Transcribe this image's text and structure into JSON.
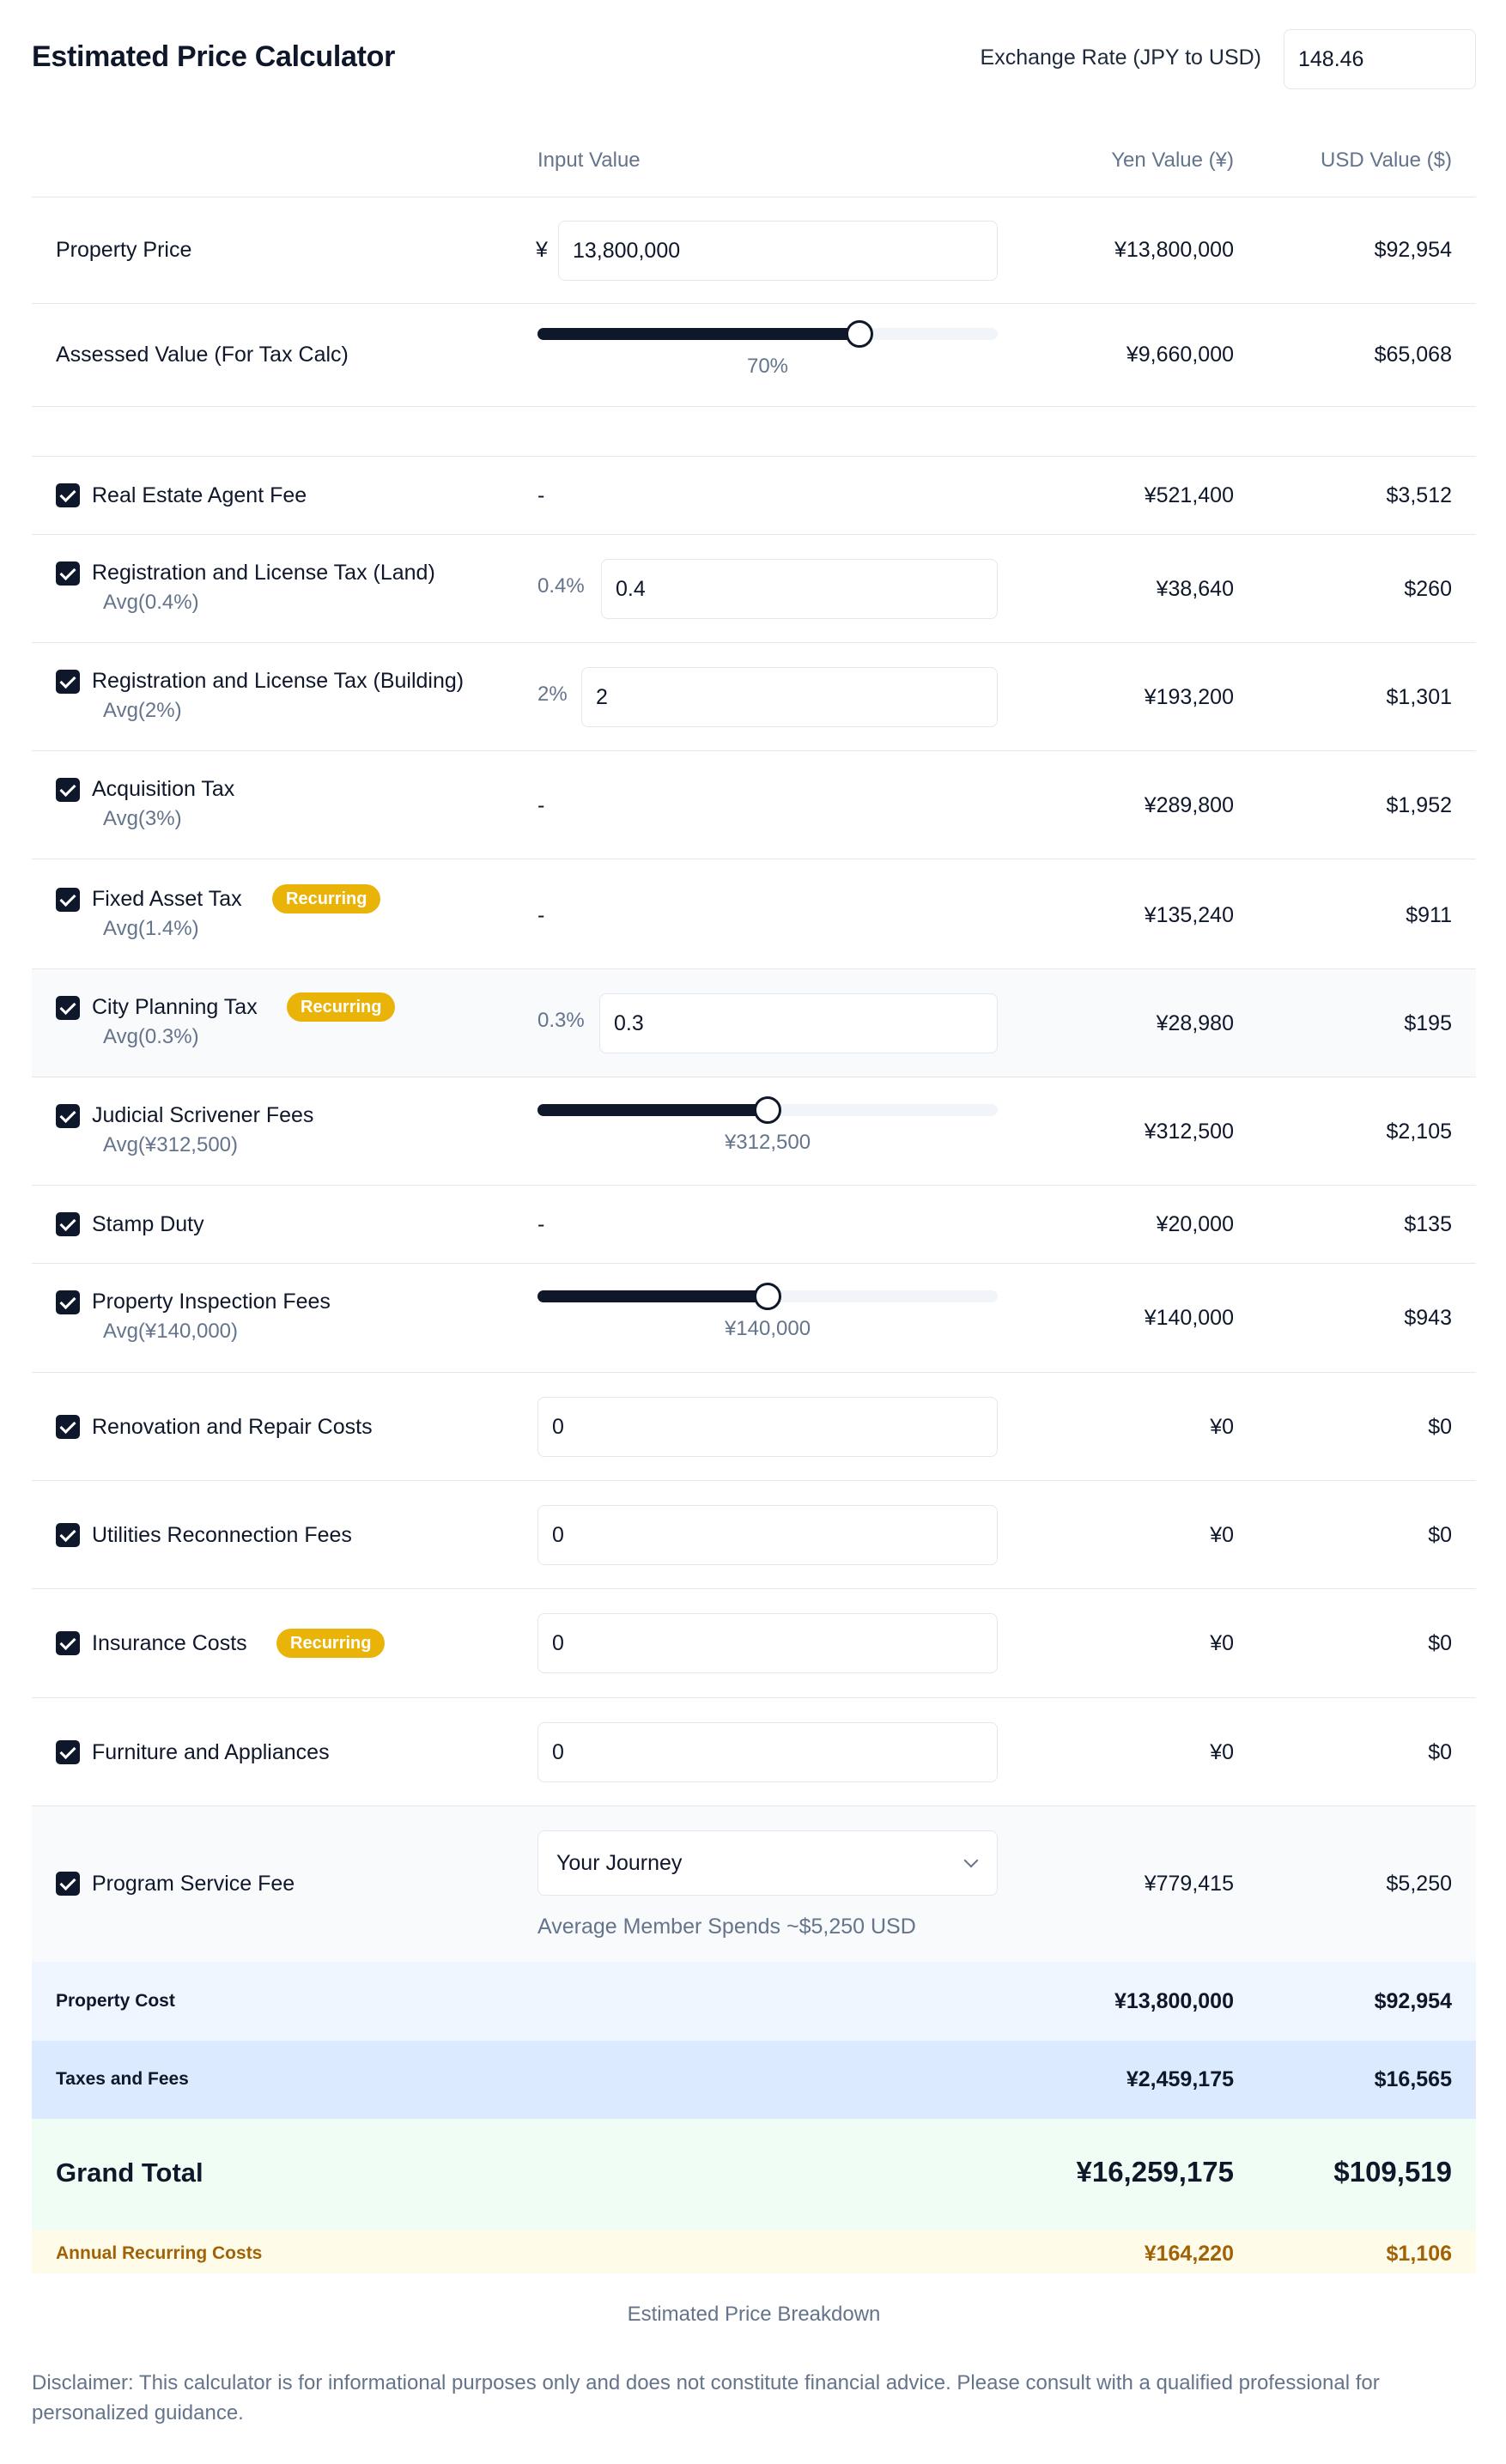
{
  "header": {
    "title": "Estimated Price Calculator",
    "rate_label": "Exchange Rate (JPY to USD)",
    "rate_value": "148.46"
  },
  "columns": {
    "input": "Input Value",
    "yen": "Yen Value (¥)",
    "usd": "USD Value ($)"
  },
  "property": {
    "label": "Property Price",
    "currency_symbol": "¥",
    "input_value": "13,800,000",
    "yen": "¥13,800,000",
    "usd": "$92,954"
  },
  "assessed": {
    "label": "Assessed Value (For Tax Calc)",
    "slider_percent": 70,
    "slider_label": "70%",
    "yen": "¥9,660,000",
    "usd": "$65,068"
  },
  "badge_label": "Recurring",
  "fees": [
    {
      "label": "Real Estate Agent Fee",
      "avg": "",
      "input": "-",
      "yen": "¥521,400",
      "usd": "$3,512",
      "checked": true
    },
    {
      "label": "Registration and License Tax (Land)",
      "avg": "Avg(0.4%)",
      "rate": "0.4%",
      "input": "0.4",
      "yen": "¥38,640",
      "usd": "$260",
      "checked": true
    },
    {
      "label": "Registration and License Tax (Building)",
      "avg": "Avg(2%)",
      "rate": "2%",
      "input": "2",
      "yen": "¥193,200",
      "usd": "$1,301",
      "checked": true
    },
    {
      "label": "Acquisition Tax",
      "avg": "Avg(3%)",
      "input": "-",
      "yen": "¥289,800",
      "usd": "$1,952",
      "checked": true
    },
    {
      "label": "Fixed Asset Tax",
      "avg": "Avg(1.4%)",
      "input": "-",
      "yen": "¥135,240",
      "usd": "$911",
      "checked": true,
      "recurring": true
    },
    {
      "label": "City Planning Tax",
      "avg": "Avg(0.3%)",
      "rate": "0.3%",
      "input": "0.3",
      "yen": "¥28,980",
      "usd": "$195",
      "checked": true,
      "recurring": true
    },
    {
      "label": "Judicial Scrivener Fees",
      "avg": "Avg(¥312,500)",
      "slider_fraction": 0.5,
      "slider_label": "¥312,500",
      "yen": "¥312,500",
      "usd": "$2,105",
      "checked": true
    },
    {
      "label": "Stamp Duty",
      "avg": "",
      "input": "-",
      "yen": "¥20,000",
      "usd": "$135",
      "checked": true
    },
    {
      "label": "Property Inspection Fees",
      "avg": "Avg(¥140,000)",
      "slider_fraction": 0.5,
      "slider_label": "¥140,000",
      "yen": "¥140,000",
      "usd": "$943",
      "checked": true
    },
    {
      "label": "Renovation and Repair Costs",
      "input": "0",
      "yen": "¥0",
      "usd": "$0",
      "checked": true
    },
    {
      "label": "Utilities Reconnection Fees",
      "input": "0",
      "yen": "¥0",
      "usd": "$0",
      "checked": true
    },
    {
      "label": "Insurance Costs",
      "input": "0",
      "yen": "¥0",
      "usd": "$0",
      "checked": true,
      "recurring": true
    },
    {
      "label": "Furniture and Appliances",
      "input": "0",
      "yen": "¥0",
      "usd": "$0",
      "checked": true
    },
    {
      "label": "Program Service Fee",
      "select_value": "Your Journey",
      "note": "Average Member Spends ~$5,250 USD",
      "yen": "¥779,415",
      "usd": "$5,250",
      "checked": true
    }
  ],
  "summary": {
    "property_cost": {
      "label": "Property Cost",
      "yen": "¥13,800,000",
      "usd": "$92,954"
    },
    "taxes_fees": {
      "label": "Taxes and Fees",
      "yen": "¥2,459,175",
      "usd": "$16,565"
    },
    "grand_total": {
      "label": "Grand Total",
      "yen": "¥16,259,175",
      "usd": "$109,519"
    },
    "annual_recurring": {
      "label": "Annual Recurring Costs",
      "yen": "¥164,220",
      "usd": "$1,106"
    }
  },
  "caption": "Estimated Price Breakdown",
  "disclaimer": "Disclaimer: This calculator is for informational purposes only and does not constitute financial advice. Please consult with a qualified professional for personalized guidance.",
  "colors": {
    "badge": "#eab308",
    "dark": "#0f172a",
    "property_bg": "#eff6ff",
    "taxes_bg": "#dbeafe",
    "total_bg": "#f0fdf4",
    "recurring_bg": "#fefce8",
    "recurring_text": "#a16207"
  }
}
